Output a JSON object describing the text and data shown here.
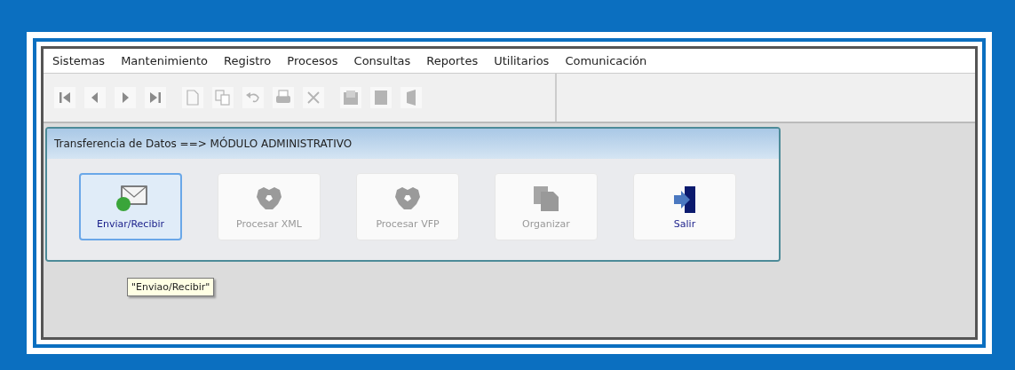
{
  "menu": [
    "Sistemas",
    "Mantenimiento",
    "Registro",
    "Procesos",
    "Consultas",
    "Reportes",
    "Utilitarios",
    "Comunicación"
  ],
  "toolbar": [
    {
      "kind": "first",
      "disabled": false
    },
    {
      "kind": "prev",
      "disabled": false
    },
    {
      "kind": "next",
      "disabled": false
    },
    {
      "kind": "last",
      "disabled": false
    },
    {
      "kind": "new",
      "disabled": true
    },
    {
      "kind": "copy",
      "disabled": true
    },
    {
      "kind": "undo",
      "disabled": true
    },
    {
      "kind": "print",
      "disabled": true
    },
    {
      "kind": "delete",
      "disabled": true
    },
    {
      "kind": "save",
      "disabled": true
    },
    {
      "kind": "block",
      "disabled": true
    },
    {
      "kind": "door",
      "disabled": true
    }
  ],
  "dialog": {
    "title": "Transferencia de Datos ==> MÓDULO ADMINISTRATIVO",
    "buttons": [
      {
        "label": "Enviar/Recibir",
        "kind": "mail",
        "disabled": false,
        "selected": true
      },
      {
        "label": "Procesar XML",
        "kind": "gear",
        "disabled": true,
        "selected": false
      },
      {
        "label": "Procesar VFP",
        "kind": "gear",
        "disabled": true,
        "selected": false
      },
      {
        "label": "Organizar",
        "kind": "folders",
        "disabled": true,
        "selected": false
      },
      {
        "label": "Salir",
        "kind": "exit",
        "disabled": false,
        "selected": false
      }
    ]
  },
  "tooltip": "\"Enviao/Recibir\""
}
